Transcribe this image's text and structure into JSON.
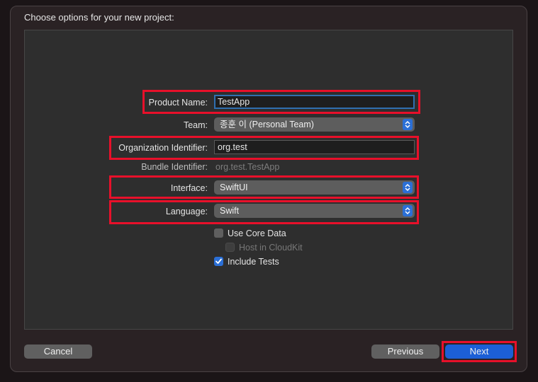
{
  "dialog": {
    "title": "Choose options for your new project:"
  },
  "form": {
    "product_name": {
      "label": "Product Name:",
      "value": "TestApp"
    },
    "team": {
      "label": "Team:",
      "value": "종훈 이 (Personal Team)"
    },
    "organization_identifier": {
      "label": "Organization Identifier:",
      "value": "org.test"
    },
    "bundle_identifier": {
      "label": "Bundle Identifier:",
      "value": "org.test.TestApp"
    },
    "interface": {
      "label": "Interface:",
      "value": "SwiftUI"
    },
    "language": {
      "label": "Language:",
      "value": "Swift"
    }
  },
  "checkboxes": {
    "use_core_data": {
      "label": "Use Core Data",
      "checked": false
    },
    "host_in_cloudkit": {
      "label": "Host in CloudKit",
      "checked": false,
      "disabled": true
    },
    "include_tests": {
      "label": "Include Tests",
      "checked": true
    }
  },
  "buttons": {
    "cancel": "Cancel",
    "previous": "Previous",
    "next": "Next"
  },
  "colors": {
    "highlight": "#e8102a",
    "accent": "#1c5fd6",
    "background": "#2e2e2e"
  },
  "icons": {
    "popup": "updown-chevron-icon",
    "check": "checkmark-icon"
  }
}
